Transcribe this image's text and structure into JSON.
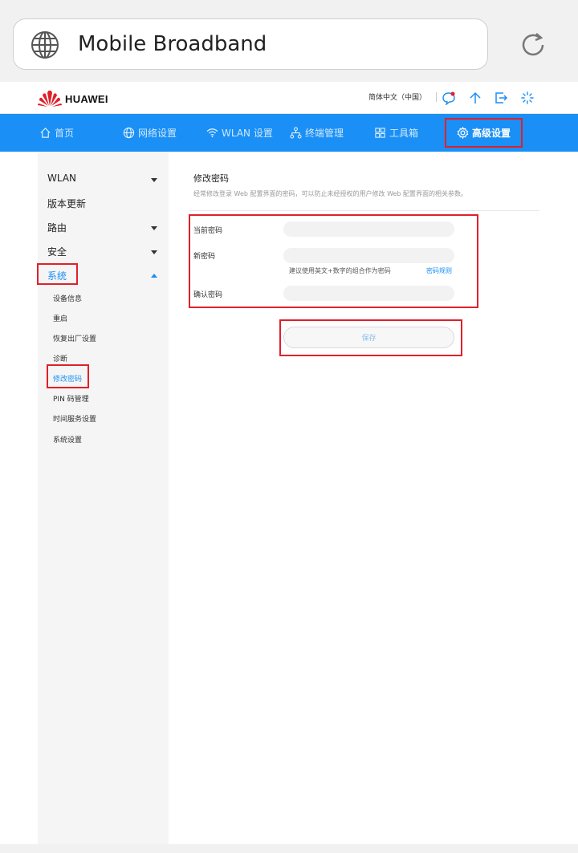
{
  "browser": {
    "title": "Mobile Broadband",
    "globe_icon": "globe-icon",
    "reload_icon": "reload-icon"
  },
  "header": {
    "brand": "HUAWEI",
    "language": "简体中文（中国）",
    "icons": [
      "message-icon",
      "upload-icon",
      "logout-icon",
      "loading-icon"
    ]
  },
  "nav": {
    "items": [
      {
        "label": "首页",
        "icon": "home-icon"
      },
      {
        "label": "网络设置",
        "icon": "globe-icon"
      },
      {
        "label": "WLAN 设置",
        "icon": "wifi-icon"
      },
      {
        "label": "终端管理",
        "icon": "devices-icon"
      },
      {
        "label": "工具箱",
        "icon": "toolbox-icon"
      },
      {
        "label": "高级设置",
        "icon": "gear-icon"
      }
    ],
    "active": "高级设置"
  },
  "sidebar": {
    "items": [
      {
        "label": "WLAN"
      },
      {
        "label": "版本更新"
      },
      {
        "label": "路由"
      },
      {
        "label": "安全"
      },
      {
        "label": "系统"
      }
    ],
    "sub_items": [
      {
        "label": "设备信息"
      },
      {
        "label": "重启"
      },
      {
        "label": "恢复出厂设置"
      },
      {
        "label": "诊断"
      },
      {
        "label": "修改密码"
      },
      {
        "label": "PIN 码管理"
      },
      {
        "label": "时间服务设置"
      },
      {
        "label": "系统设置"
      }
    ]
  },
  "content": {
    "title": "修改密码",
    "description": "经常修改登录 Web 配置界面的密码，可以防止未经授权的用户修改 Web 配置界面的相关参数。",
    "fields": {
      "current_label": "当前密码",
      "current_value": "",
      "new_label": "新密码",
      "new_value": "",
      "confirm_label": "确认密码",
      "confirm_value": ""
    },
    "hint": "建议使用英文+数字的组合作为密码",
    "hint_link": "密码规则",
    "save_label": "保存"
  },
  "colors": {
    "nav_bg": "#1a8ff5",
    "highlight": "#e0202a",
    "link": "#1a8ff5"
  }
}
